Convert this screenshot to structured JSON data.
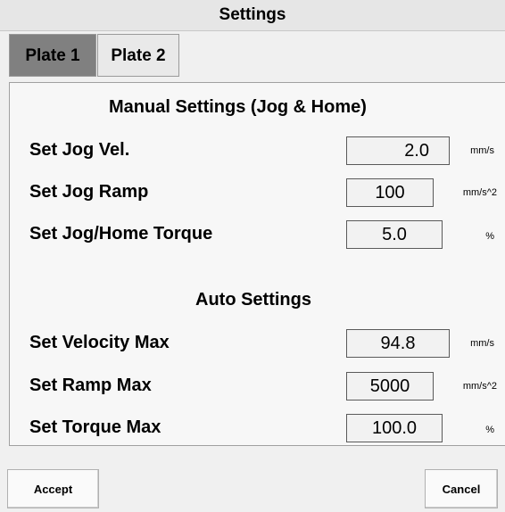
{
  "window": {
    "title": "Settings"
  },
  "tabs": [
    {
      "label": "Plate 1",
      "active": true
    },
    {
      "label": "Plate 2",
      "active": false
    }
  ],
  "manual": {
    "heading": "Manual Settings (Jog & Home)",
    "rows": [
      {
        "label": "Set Jog Vel.",
        "value": "2.0",
        "unit": "mm/s"
      },
      {
        "label": "Set Jog Ramp",
        "value": "100",
        "unit": "mm/s^2"
      },
      {
        "label": "Set Jog/Home Torque",
        "value": "5.0",
        "unit": "%"
      }
    ]
  },
  "auto": {
    "heading": "Auto Settings",
    "rows": [
      {
        "label": "Set Velocity Max",
        "value": "94.8",
        "unit": "mm/s"
      },
      {
        "label": "Set Ramp Max",
        "value": "5000",
        "unit": "mm/s^2"
      },
      {
        "label": "Set Torque Max",
        "value": "100.0",
        "unit": "%"
      }
    ]
  },
  "buttons": {
    "accept": "Accept",
    "cancel": "Cancel"
  }
}
